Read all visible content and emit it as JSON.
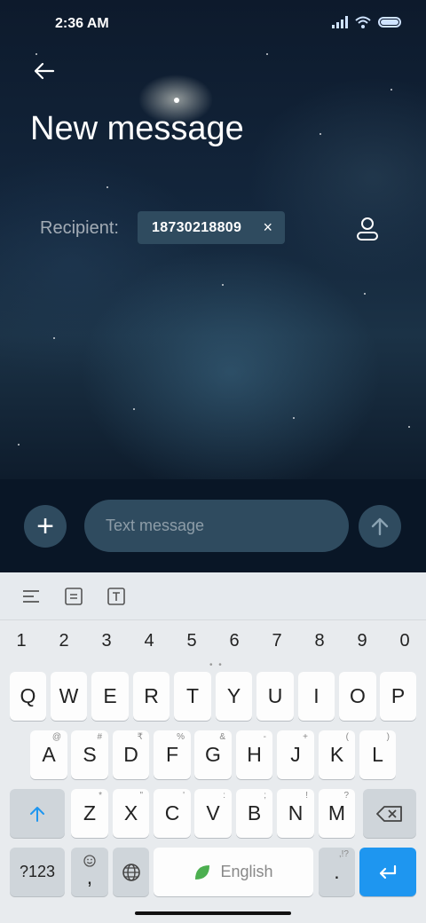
{
  "status_bar": {
    "time": "2:36 AM"
  },
  "header": {
    "title": "New message"
  },
  "recipient": {
    "label": "Recipient:",
    "number": "18730218809",
    "remove_glyph": "×"
  },
  "compose": {
    "placeholder": "Text message",
    "add_glyph": "+"
  },
  "keyboard": {
    "number_row": [
      "1",
      "2",
      "3",
      "4",
      "5",
      "6",
      "7",
      "8",
      "9",
      "0"
    ],
    "row1": [
      "Q",
      "W",
      "E",
      "R",
      "T",
      "Y",
      "U",
      "I",
      "O",
      "P"
    ],
    "row2": [
      {
        "label": "A",
        "hint": "@"
      },
      {
        "label": "S",
        "hint": "#"
      },
      {
        "label": "D",
        "hint": "₹"
      },
      {
        "label": "F",
        "hint": "%"
      },
      {
        "label": "G",
        "hint": "&"
      },
      {
        "label": "H",
        "hint": "-"
      },
      {
        "label": "J",
        "hint": "+"
      },
      {
        "label": "K",
        "hint": "("
      },
      {
        "label": "L",
        "hint": ")"
      }
    ],
    "row3": [
      {
        "label": "Z",
        "hint": "*"
      },
      {
        "label": "X",
        "hint": "\""
      },
      {
        "label": "C",
        "hint": "'"
      },
      {
        "label": "V",
        "hint": ":"
      },
      {
        "label": "B",
        "hint": ";"
      },
      {
        "label": "N",
        "hint": "!"
      },
      {
        "label": "M",
        "hint": "?"
      }
    ],
    "symbols_label": "?123",
    "comma_label": ",",
    "space_label": "English",
    "period_label": ".",
    "period_hint": ",!?"
  },
  "colors": {
    "accent": "#1e96f0",
    "chip": "#2f4b5f",
    "compose_bg": "#091626"
  }
}
